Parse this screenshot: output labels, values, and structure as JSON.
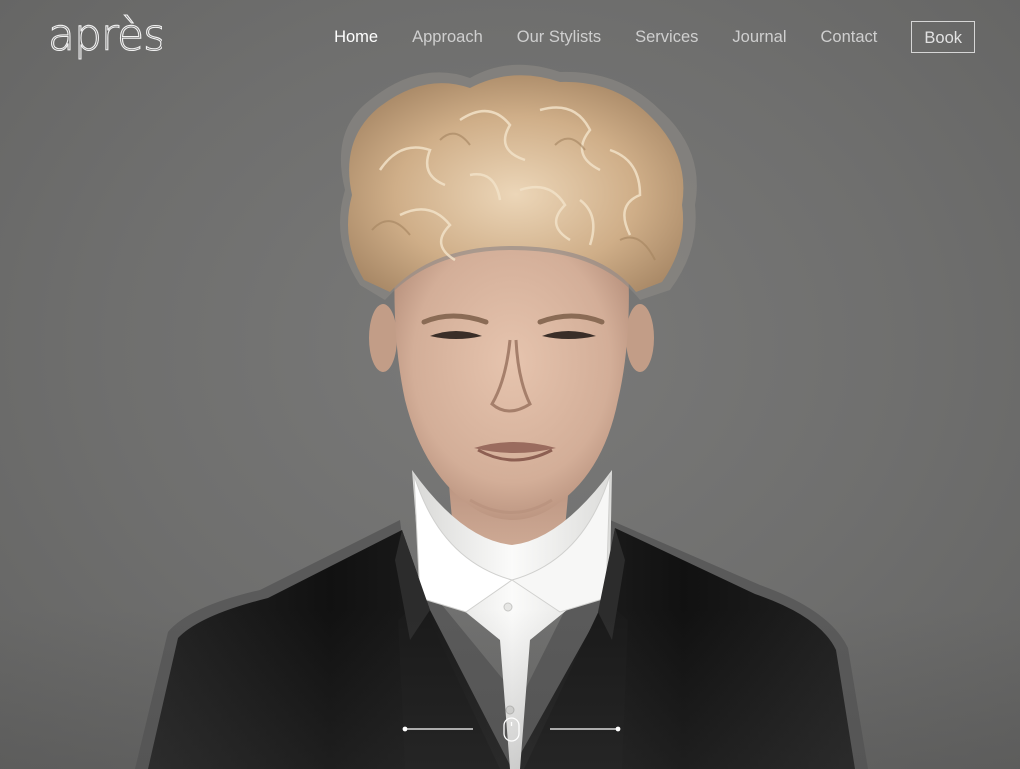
{
  "brand": {
    "logo_text": "après"
  },
  "nav": {
    "items": [
      {
        "label": "Home",
        "active": true
      },
      {
        "label": "Approach",
        "active": false
      },
      {
        "label": "Our Stylists",
        "active": false
      },
      {
        "label": "Services",
        "active": false
      },
      {
        "label": "Journal",
        "active": false
      },
      {
        "label": "Contact",
        "active": false
      }
    ],
    "book_label": "Book"
  },
  "hero": {
    "background_color": "#6e6e6d",
    "scroll_icon": "mouse-icon"
  },
  "colors": {
    "nav_active": "#ffffff",
    "nav_inactive": "#cfcfcf",
    "suit": "#141414",
    "shirt": "#f1f1ef",
    "hair": "#d8b894",
    "skin": "#d9b7a0"
  }
}
